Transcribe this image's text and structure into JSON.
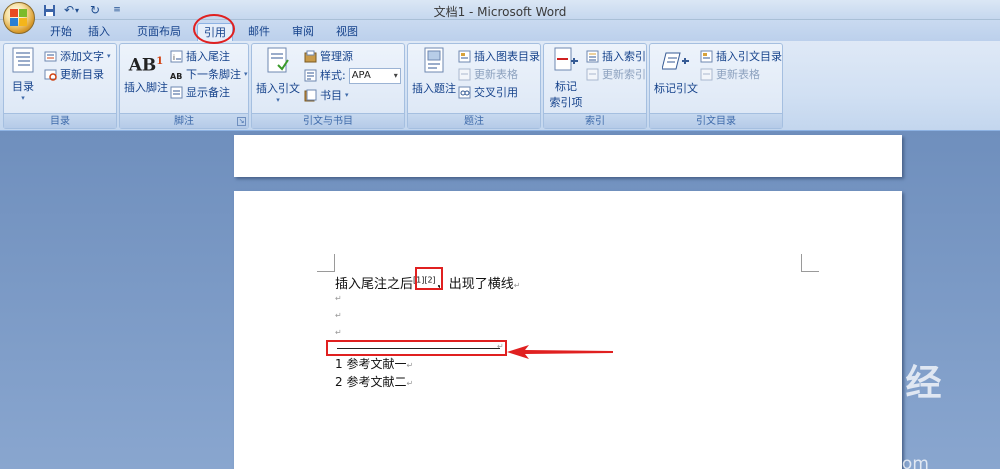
{
  "window": {
    "title": "文档1 - Microsoft Word"
  },
  "quick_access": [
    "save-icon",
    "undo-icon",
    "redo-icon",
    "customize-icon"
  ],
  "tabs": [
    {
      "label": "开始"
    },
    {
      "label": "插入"
    },
    {
      "label": "页面布局"
    },
    {
      "label": "引用",
      "active": true
    },
    {
      "label": "邮件"
    },
    {
      "label": "审阅"
    },
    {
      "label": "视图"
    }
  ],
  "ribbon": {
    "toc": {
      "label": "目录",
      "big_button": "目录",
      "add_text": "添加文字",
      "update_toc": "更新目录"
    },
    "footnotes": {
      "label": "脚注",
      "insert_footnote": "插入脚注",
      "insert_endnote": "插入尾注",
      "next_footnote": "下一条脚注",
      "show_notes": "显示备注"
    },
    "citations": {
      "label": "引文与书目",
      "insert_citation": "插入引文",
      "manage_sources": "管理源",
      "style_label": "样式:",
      "style_value": "APA",
      "bibliography": "书目"
    },
    "captions": {
      "label": "题注",
      "insert_caption": "插入题注",
      "insert_table_of_figures": "插入图表目录",
      "update_table": "更新表格",
      "cross_reference": "交叉引用"
    },
    "index": {
      "label": "索引",
      "mark_entry_line1": "标记",
      "mark_entry_line2": "索引项",
      "insert_index": "插入索引",
      "update_index": "更新索引"
    },
    "toa": {
      "label": "引文目录",
      "mark_citation": "标记引文",
      "insert_toa": "插入引文目录",
      "update_table": "更新表格"
    }
  },
  "document": {
    "line1_before": "插入尾注之后",
    "line1_refs": "[1][2]",
    "line1_after": "，出现了横线",
    "para_mark": "↵",
    "footnote1": "1 参考文献一",
    "footnote2": "2 参考文献二"
  },
  "annotation": {
    "color": "#e02020"
  },
  "watermark": {
    "logo": "Bai du 经验",
    "url": "jingyan.baidu.com"
  }
}
